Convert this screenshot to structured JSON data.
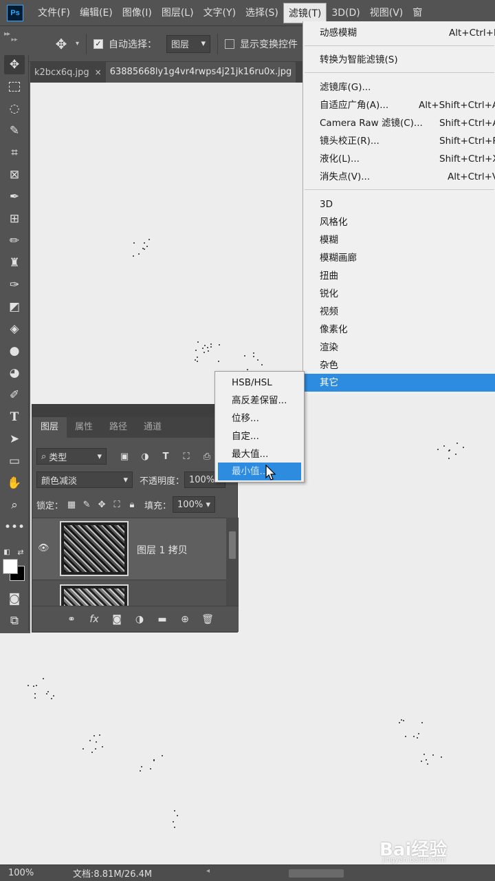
{
  "app": {
    "logo_text": "Ps",
    "menus": [
      "文件(F)",
      "编辑(E)",
      "图像(I)",
      "图层(L)",
      "文字(Y)",
      "选择(S)",
      "滤镜(T)",
      "3D(D)",
      "视图(V)",
      "窗"
    ]
  },
  "options": {
    "auto_select_label": "自动选择：",
    "auto_select_target": "图层",
    "show_transform_label": "显示变换控件"
  },
  "tabs": [
    {
      "label": "k2bcx6q.jpg",
      "close": "×"
    },
    {
      "label": "63885668ly1g4vr4rwps4j21jk16ru0x.jpg",
      "close": ""
    }
  ],
  "filter_menu": {
    "items": [
      {
        "label": "动感模糊",
        "shortcut": "Alt+Ctrl+F"
      },
      {
        "label": "转换为智能滤镜(S)",
        "shortcut": ""
      },
      {
        "label": "滤镜库(G)...",
        "shortcut": ""
      },
      {
        "label": "自适应广角(A)...",
        "shortcut": "Alt+Shift+Ctrl+A"
      },
      {
        "label": "Camera Raw 滤镜(C)...",
        "shortcut": "Shift+Ctrl+A"
      },
      {
        "label": "镜头校正(R)...",
        "shortcut": "Shift+Ctrl+R"
      },
      {
        "label": "液化(L)...",
        "shortcut": "Shift+Ctrl+X"
      },
      {
        "label": "消失点(V)...",
        "shortcut": "Alt+Ctrl+V"
      },
      {
        "label": "3D",
        "shortcut": ""
      },
      {
        "label": "风格化",
        "shortcut": ""
      },
      {
        "label": "模糊",
        "shortcut": ""
      },
      {
        "label": "模糊画廊",
        "shortcut": ""
      },
      {
        "label": "扭曲",
        "shortcut": ""
      },
      {
        "label": "锐化",
        "shortcut": ""
      },
      {
        "label": "视频",
        "shortcut": ""
      },
      {
        "label": "像素化",
        "shortcut": ""
      },
      {
        "label": "渲染",
        "shortcut": ""
      },
      {
        "label": "杂色",
        "shortcut": ""
      },
      {
        "label": "其它",
        "shortcut": ""
      }
    ]
  },
  "other_submenu": {
    "items": [
      "HSB/HSL",
      "高反差保留...",
      "位移...",
      "自定...",
      "最大值...",
      "最小值..."
    ]
  },
  "layers_panel": {
    "tabs": [
      "图层",
      "属性",
      "路径",
      "通道"
    ],
    "filter_kind": "类型",
    "blend_mode": "颜色减淡",
    "opacity_label": "不透明度：",
    "opacity_value": "100%",
    "lock_label": "锁定：",
    "fill_label": "填充：",
    "fill_value": "100%",
    "layers": [
      {
        "name": "图层 1 拷贝"
      },
      {
        "name": ""
      }
    ]
  },
  "status": {
    "zoom": "100%",
    "doc_info": "文档:8.81M/26.4M"
  },
  "watermark": {
    "brand": "Bai经验",
    "url": "jingyan.baidu.com"
  },
  "colors": {
    "accent": "#2e8ce0",
    "panel": "#535353",
    "canvas": "#ededed"
  }
}
